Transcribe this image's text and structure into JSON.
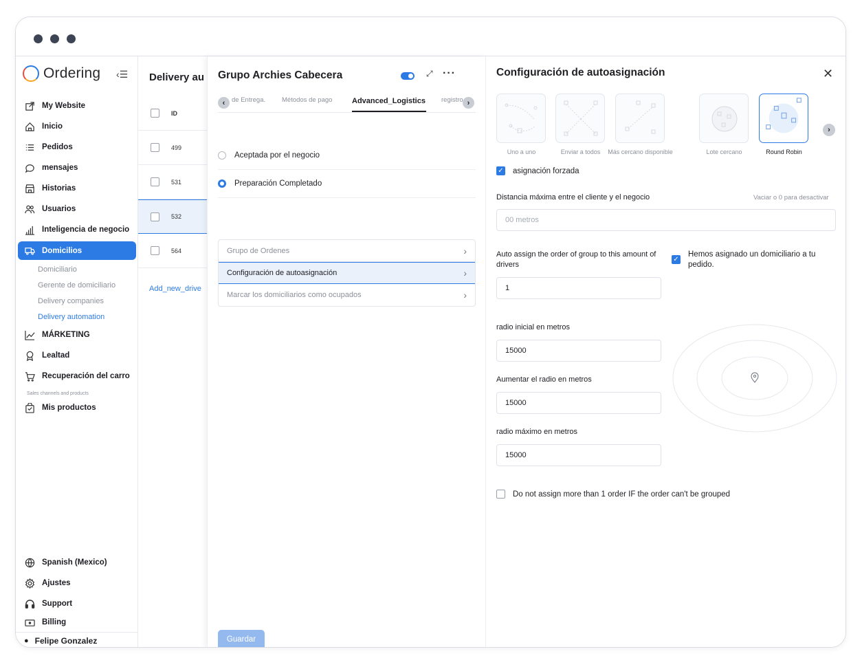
{
  "sidebar": {
    "brand": "Ordering",
    "items": [
      {
        "label": "My Website"
      },
      {
        "label": "Inicio"
      },
      {
        "label": "Pedidos"
      },
      {
        "label": "mensajes"
      },
      {
        "label": "Historias"
      },
      {
        "label": "Usuarios"
      },
      {
        "label": "Inteligencia de negocio"
      },
      {
        "label": "Domicilios"
      }
    ],
    "subitems": [
      {
        "label": "Domiciliario"
      },
      {
        "label": "Gerente de domiciliario"
      },
      {
        "label": "Delivery companies"
      },
      {
        "label": "Delivery automation"
      }
    ],
    "items2": [
      {
        "label": "MÁRKETING"
      },
      {
        "label": "Lealtad"
      },
      {
        "label": "Recuperación del carro"
      }
    ],
    "section_label": "Sales channels and products",
    "items3": [
      {
        "label": "Mis productos"
      }
    ],
    "bottom": [
      {
        "label": "Spanish (Mexico)"
      },
      {
        "label": "Ajustes"
      },
      {
        "label": "Support"
      },
      {
        "label": "Billing"
      }
    ],
    "user": "Felipe Gonzalez"
  },
  "list": {
    "title": "Delivery au",
    "header": "ID",
    "rows": [
      "499",
      "531",
      "532",
      "564"
    ],
    "add_link": "Add_new_drive"
  },
  "mid": {
    "title": "Grupo Archies Cabecera",
    "tabs": [
      "de Entrega.",
      "Métodos de pago",
      "Advanced_Logistics",
      "registro"
    ],
    "radios": [
      {
        "label": "Aceptada por el negocio"
      },
      {
        "label": "Preparación Completado"
      }
    ],
    "menu": [
      {
        "label": "Grupo de Ordenes"
      },
      {
        "label": "Configuración de autoasignación"
      },
      {
        "label": "Marcar los domiciliarios como ocupados"
      }
    ],
    "save": "Guardar"
  },
  "right": {
    "title": "Configuración de autoasignación",
    "strategies": [
      "Uno a uno",
      "Enviar a todos",
      "Más cercano disponible",
      "Lote cercano",
      "Round Robin"
    ],
    "forced_label": "asignación forzada",
    "distance_label": "Distancia máxima entre el cliente y el negocio",
    "distance_hint": "Vaciar o 0 para desactivar",
    "distance_placeholder": "00 metros",
    "group_label": "Auto assign the order of group to this amount of drivers",
    "group_value": "1",
    "assigned_label": "Hemos asignado un domiciliario a tu pedido.",
    "radius_initial_label": "radio inicial en metros",
    "radius_initial_value": "15000",
    "radius_increase_label": "Aumentar el radio en metros",
    "radius_increase_value": "15000",
    "radius_max_label": "radio máximo en metros",
    "radius_max_value": "15000",
    "no_group_label": "Do not assign more than 1 order IF the order can't be grouped"
  },
  "colors": {
    "accent": "#2c7be5",
    "text": "#1c1c22",
    "muted": "#8c909a"
  }
}
